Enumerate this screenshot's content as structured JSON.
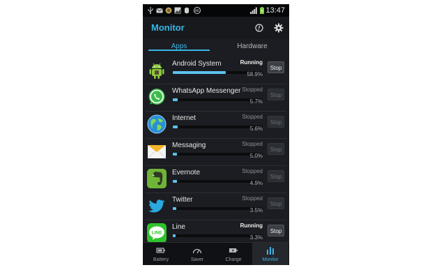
{
  "statusbar": {
    "time": "13:47",
    "icons": [
      "usb-icon",
      "mail-icon",
      "app-icon",
      "gallery-icon",
      "evernote-icon",
      "ae-icon",
      "signal-icon",
      "battery-charging-icon"
    ]
  },
  "app": {
    "title": "Monitor"
  },
  "header_icons": [
    "help-icon",
    "settings-icon"
  ],
  "tabs": [
    {
      "label": "Apps",
      "active": true
    },
    {
      "label": "Hardware",
      "active": false
    }
  ],
  "apps": [
    {
      "name": "Android System",
      "status": "Running",
      "percent": "58.9%",
      "fraction": 0.589,
      "stop_label": "Stop",
      "stop_enabled": true,
      "icon": "android-icon"
    },
    {
      "name": "WhatsApp Messenger",
      "status": "Stopped",
      "percent": "5.7%",
      "fraction": 0.057,
      "stop_label": "Stop",
      "stop_enabled": false,
      "icon": "whatsapp-icon"
    },
    {
      "name": "Internet",
      "status": "Stopped",
      "percent": "5.6%",
      "fraction": 0.056,
      "stop_label": "Stop",
      "stop_enabled": false,
      "icon": "internet-globe-icon"
    },
    {
      "name": "Messaging",
      "status": "Stopped",
      "percent": "5.0%",
      "fraction": 0.05,
      "stop_label": "Stop",
      "stop_enabled": false,
      "icon": "messaging-envelope-icon"
    },
    {
      "name": "Evernote",
      "status": "Stopped",
      "percent": "4.9%",
      "fraction": 0.049,
      "stop_label": "Stop",
      "stop_enabled": false,
      "icon": "evernote-elephant-icon"
    },
    {
      "name": "Twitter",
      "status": "Stopped",
      "percent": "3.5%",
      "fraction": 0.035,
      "stop_label": "Stop",
      "stop_enabled": false,
      "icon": "twitter-bird-icon"
    },
    {
      "name": "Line",
      "status": "Running",
      "percent": "3.3%",
      "fraction": 0.033,
      "stop_label": "Stop",
      "stop_enabled": true,
      "icon": "line-icon"
    }
  ],
  "line_icon_text": "LINE",
  "nav": [
    {
      "label": "Battery",
      "icon": "battery-icon",
      "active": false
    },
    {
      "label": "Saver",
      "icon": "gauge-icon",
      "active": false
    },
    {
      "label": "Charge",
      "icon": "charge-icon",
      "active": false
    },
    {
      "label": "Monitor",
      "icon": "monitor-bars-icon",
      "active": true
    }
  ],
  "colors": {
    "accent": "#3ab5e6",
    "bar_fill": "#5cc3ee",
    "background": "#1b1d22"
  }
}
